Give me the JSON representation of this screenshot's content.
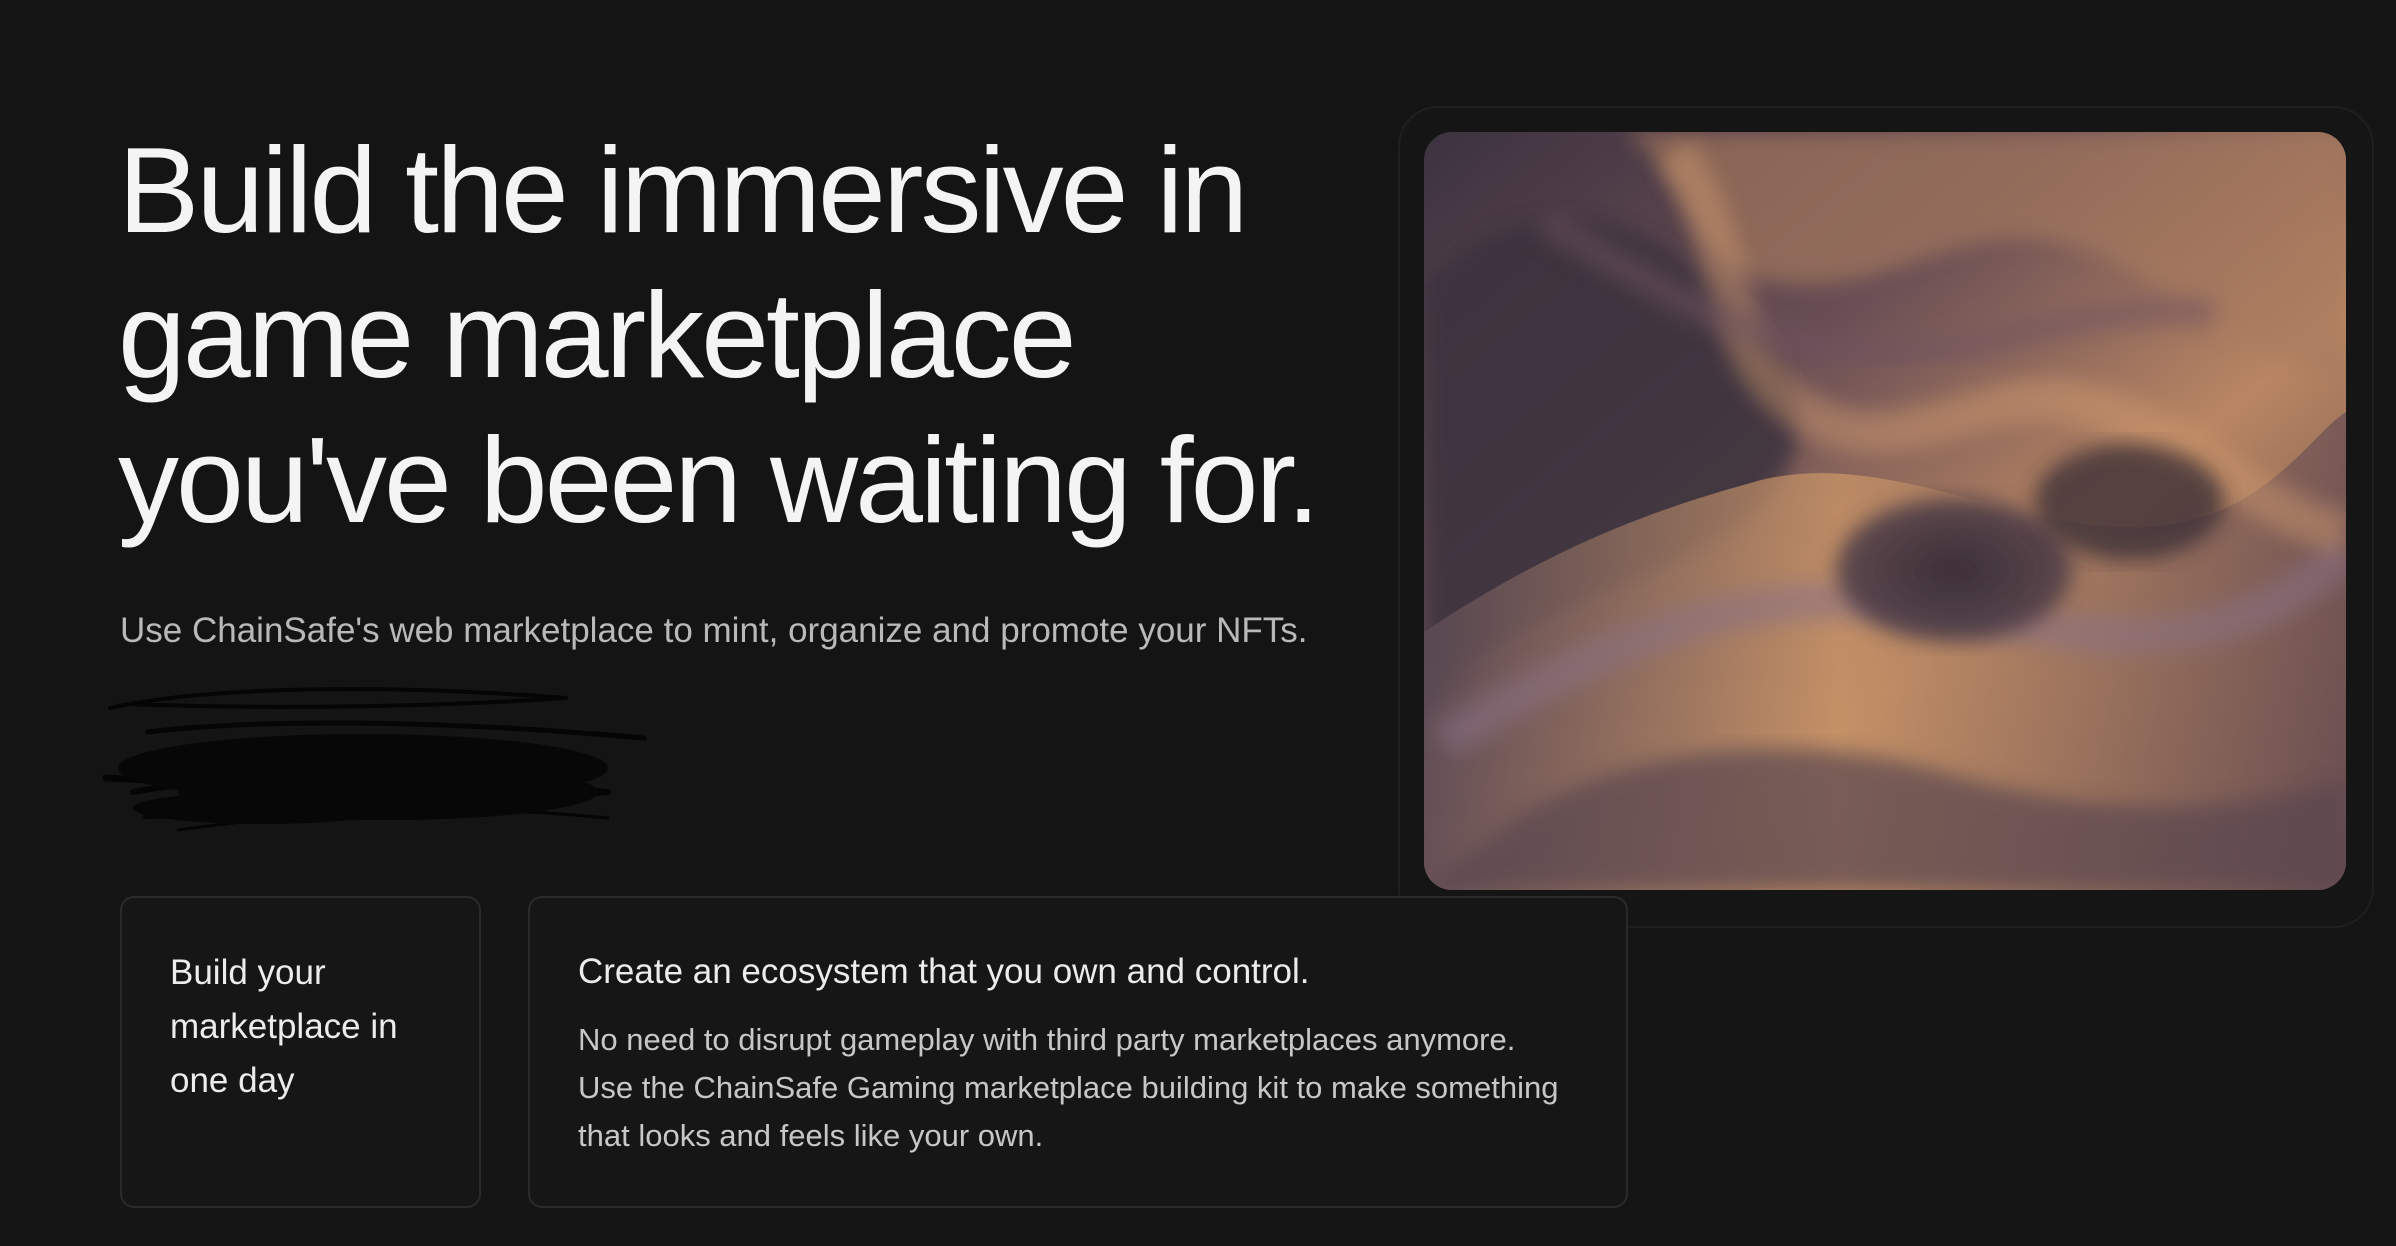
{
  "hero": {
    "title_line_1": "Build the immersive in",
    "title_line_2": "game marketplace",
    "title_line_3": "you've been waiting for.",
    "subtitle": "Use ChainSafe's web marketplace to mint, organize and promote your NFTs."
  },
  "cards": {
    "left_title": "Build your marketplace in one day",
    "right_title": "Create an ecosystem that you own and control.",
    "right_body": "No need to disrupt gameplay with third party marketplaces anymore. Use the ChainSafe Gaming marketplace building kit to make something that looks and feels like your own."
  },
  "colors": {
    "background": "#141414",
    "text": "#f4f4f4",
    "muted_text": "#b9b9b9",
    "art_warm": "#b98663",
    "art_dark": "#3f3342"
  }
}
